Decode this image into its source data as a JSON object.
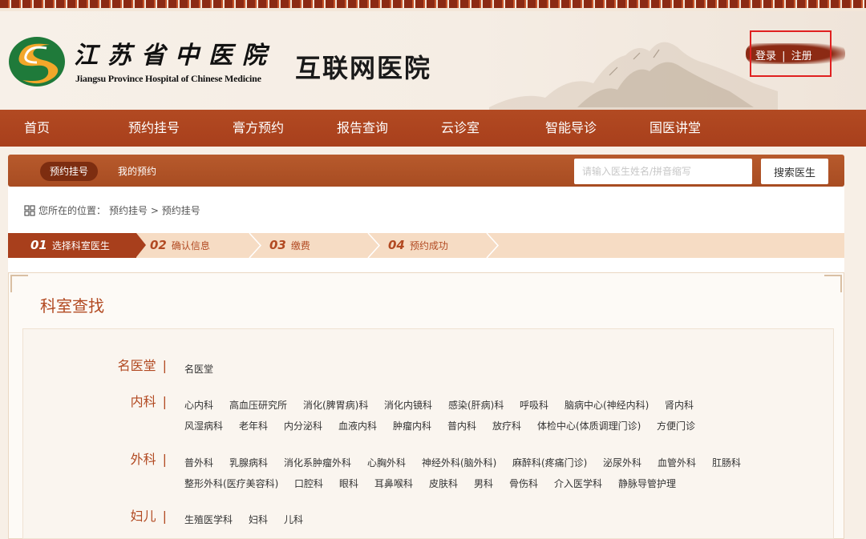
{
  "header": {
    "hospital_name_cn": "江苏省中医院",
    "hospital_name_en": "Jiangsu Province Hospital of Chinese Medicine",
    "site_title": "互联网医院",
    "login": "登录",
    "separator": "|",
    "register": "注册",
    "accent_color": "#a83f1c"
  },
  "nav": {
    "items": [
      "首页",
      "预约挂号",
      "膏方预约",
      "报告查询",
      "云诊室",
      "智能导诊",
      "国医讲堂"
    ]
  },
  "subbar": {
    "tab_active": "预约挂号",
    "tab_mine": "我的预约",
    "search_placeholder": "请输入医生姓名/拼音缩写",
    "search_button": "搜索医生"
  },
  "breadcrumb": {
    "prefix": "您所在的位置：",
    "path": "预约挂号 > 预约挂号"
  },
  "steps": [
    {
      "num": "01",
      "label": "选择科室医生"
    },
    {
      "num": "02",
      "label": "确认信息"
    },
    {
      "num": "03",
      "label": "缴费"
    },
    {
      "num": "04",
      "label": "预约成功"
    }
  ],
  "panel": {
    "title": "科室查找"
  },
  "categories": [
    {
      "name": "名医堂",
      "rows": [
        [
          "名医堂"
        ]
      ]
    },
    {
      "name": "内科",
      "rows": [
        [
          "心内科",
          "高血压研究所",
          "消化(脾胃病)科",
          "消化内镜科",
          "感染(肝病)科",
          "呼吸科",
          "脑病中心(神经内科)",
          "肾内科"
        ],
        [
          "风湿病科",
          "老年科",
          "内分泌科",
          "血液内科",
          "肿瘤内科",
          "普内科",
          "放疗科",
          "体检中心(体质调理门诊)",
          "方便门诊"
        ]
      ]
    },
    {
      "name": "外科",
      "rows": [
        [
          "普外科",
          "乳腺病科",
          "消化系肿瘤外科",
          "心胸外科",
          "神经外科(脑外科)",
          "麻醉科(疼痛门诊)",
          "泌尿外科",
          "血管外科",
          "肛肠科"
        ],
        [
          "整形外科(医疗美容科)",
          "口腔科",
          "眼科",
          "耳鼻喉科",
          "皮肤科",
          "男科",
          "骨伤科",
          "介入医学科",
          "静脉导管护理"
        ]
      ]
    },
    {
      "name": "妇儿",
      "rows": [
        [
          "生殖医学科",
          "妇科",
          "儿科"
        ]
      ]
    }
  ],
  "category_separator": "|"
}
